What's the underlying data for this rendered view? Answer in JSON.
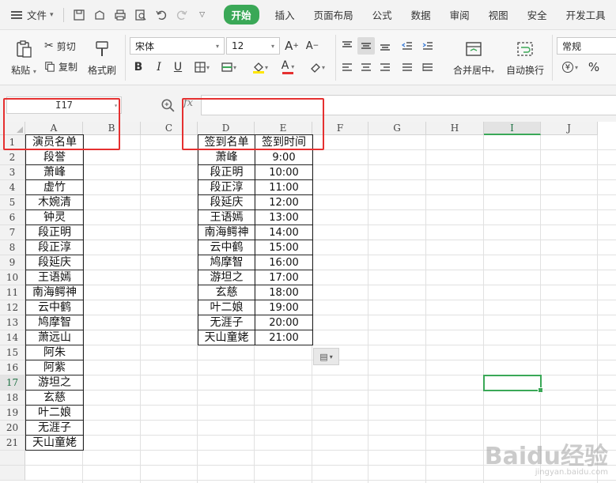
{
  "menu": {
    "file_label": "文件",
    "tabs": [
      "开始",
      "插入",
      "页面布局",
      "公式",
      "数据",
      "审阅",
      "视图",
      "安全",
      "开发工具"
    ],
    "active_tab": "开始"
  },
  "ribbon": {
    "paste": "粘贴",
    "cut": "剪切",
    "copy": "复制",
    "format_painter": "格式刷",
    "font_name": "宋体",
    "font_size": "12",
    "merge_center": "合并居中",
    "wrap_text": "自动换行",
    "number_format": "常规",
    "percent": "%"
  },
  "formula_bar": {
    "name_box": "I17",
    "fx": "fx",
    "formula": ""
  },
  "grid": {
    "columns": [
      "A",
      "B",
      "C",
      "D",
      "E",
      "F",
      "G",
      "H",
      "I",
      "J"
    ],
    "selected_column": "I",
    "rows": [
      "1",
      "2",
      "3",
      "4",
      "5",
      "6",
      "7",
      "8",
      "9",
      "10",
      "11",
      "12",
      "13",
      "14",
      "15",
      "16",
      "17",
      "18",
      "19",
      "20",
      "21"
    ],
    "selected_row": "17",
    "column_a": [
      "演员名单",
      "段誉",
      "萧峰",
      "虚竹",
      "木婉清",
      "钟灵",
      "段正明",
      "段正淳",
      "段延庆",
      "王语嫣",
      "南海鳄神",
      "云中鹤",
      "鸠摩智",
      "萧远山",
      "阿朱",
      "阿紫",
      "游坦之",
      "玄慈",
      "叶二娘",
      "无涯子",
      "天山童姥"
    ],
    "column_d": [
      "签到名单",
      "萧峰",
      "段正明",
      "段正淳",
      "段延庆",
      "王语嫣",
      "南海鳄神",
      "云中鹤",
      "鸠摩智",
      "游坦之",
      "玄慈",
      "叶二娘",
      "无涯子",
      "天山童姥"
    ],
    "column_e": [
      "签到时间",
      "9:00",
      "10:00",
      "11:00",
      "12:00",
      "13:00",
      "14:00",
      "15:00",
      "16:00",
      "17:00",
      "18:00",
      "19:00",
      "20:00",
      "21:00"
    ]
  },
  "watermark": {
    "brand": "Baidu经验",
    "url": "jingyan.baidu.com"
  },
  "colors": {
    "accent": "#3aa857",
    "annotation_red": "#e53030"
  }
}
